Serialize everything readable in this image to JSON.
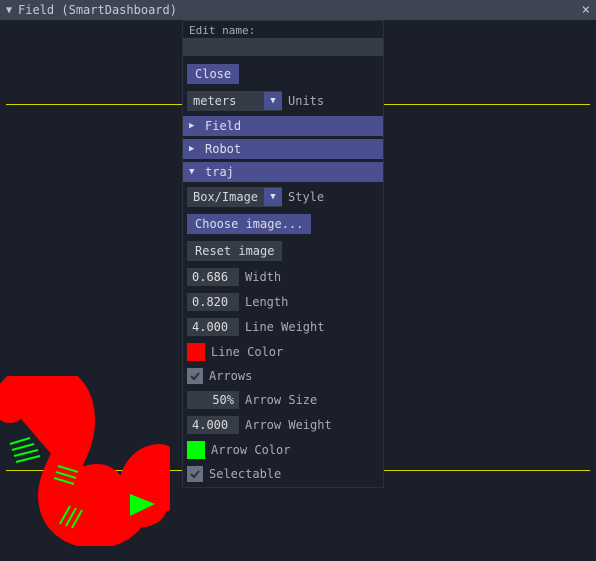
{
  "window": {
    "title": "Field (SmartDashboard)"
  },
  "panel": {
    "edit_name_label": "Edit name:",
    "edit_name_value": "",
    "close_btn": "Close",
    "units_value": "meters",
    "units_label": "Units",
    "tree": {
      "field": "Field",
      "robot": "Robot",
      "traj": "traj"
    },
    "style_value": "Box/Image",
    "style_label": "Style",
    "choose_image_btn": "Choose image...",
    "reset_image_btn": "Reset image",
    "width_value": "0.686",
    "width_label": "Width",
    "length_value": "0.820",
    "length_label": "Length",
    "line_weight_value": "4.000",
    "line_weight_label": "Line Weight",
    "line_color": "#ff0000",
    "line_color_label": "Line Color",
    "arrows_checked": true,
    "arrows_label": "Arrows",
    "arrow_size_value": "50%",
    "arrow_size_label": "Arrow Size",
    "arrow_weight_value": "4.000",
    "arrow_weight_label": "Arrow Weight",
    "arrow_color": "#00ff00",
    "arrow_color_label": "Arrow Color",
    "selectable_checked": true,
    "selectable_label": "Selectable"
  }
}
